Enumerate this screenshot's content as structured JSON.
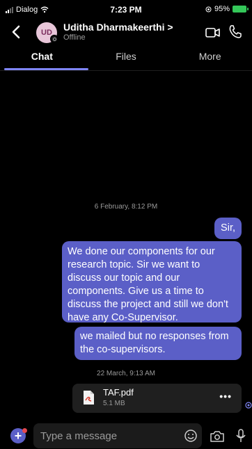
{
  "status_bar": {
    "carrier": "Dialog",
    "time": "7:23 PM",
    "battery": "95%"
  },
  "header": {
    "avatar_initials": "UD",
    "name": "Uditha Dharmakeerthi >",
    "status": "Offline"
  },
  "tabs": [
    {
      "label": "Chat",
      "active": true
    },
    {
      "label": "Files",
      "active": false
    },
    {
      "label": "More",
      "active": false
    }
  ],
  "messages": {
    "date1": "6 February, 8:12 PM",
    "m1": "Sir,",
    "m2": "We done our components for our research topic. Sir we want to discuss our topic and our components. Give us a time to discuss the project and still we don't have any Co-Supervisor.",
    "m3": "we mailed but no responses from the co-supervisors.",
    "date2": "22 March, 9:13 AM",
    "file": {
      "name": "TAF.pdf",
      "size": "5.1 MB",
      "more": "•••"
    }
  },
  "composer": {
    "placeholder": "Type a message"
  },
  "colors": {
    "accent": "#5b5fc7",
    "tab_indicator": "#7f85f5",
    "battery": "#34c759"
  }
}
